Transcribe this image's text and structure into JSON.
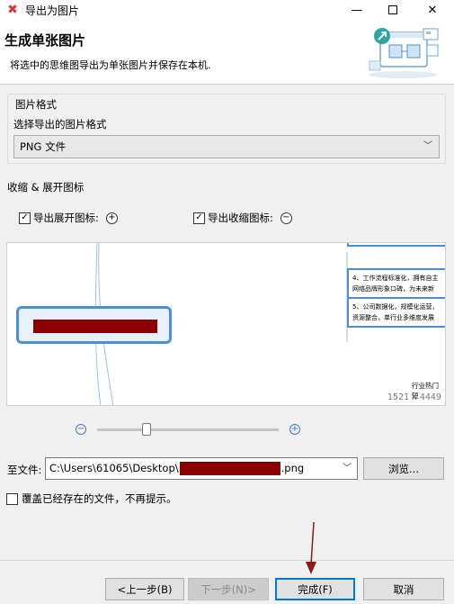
{
  "window": {
    "title": "导出为图片",
    "app_icon": "xmind-logo-icon",
    "controls": {
      "minimize": "—",
      "close": "✕"
    }
  },
  "header": {
    "title": "生成单张图片",
    "subtitle": "将选中的思维图导出为单张图片并保存在本机."
  },
  "format_group": {
    "legend": "图片格式",
    "label": "选择导出的图片格式",
    "selected": "PNG 文件"
  },
  "collapse_section": {
    "label": "收缩 & 展开图标",
    "export_expand": {
      "label": "导出展开图标:",
      "checked": true,
      "icon": "plus-circle-icon"
    },
    "export_collapse": {
      "label": "导出收缩图标:",
      "checked": true,
      "icon": "minus-circle-icon"
    }
  },
  "preview": {
    "node_lines": [
      "4、工作流程标准化，拥有自主",
      "网络品牌形象口碑，为未来新",
      "5、公司数据化，规模化运营，",
      "资源整合，单行业多维度发展"
    ],
    "trend_label": "行业热门短",
    "dimensions": "1521 x 4449"
  },
  "zoom": {
    "minus": "−",
    "plus": "+",
    "level": 0.25
  },
  "file": {
    "label": "至文件:",
    "path_prefix": "C:\\Users\\61065\\Desktop\\",
    "path_suffix": ".png",
    "browse": "浏览..."
  },
  "overwrite": {
    "label": "覆盖已经存在的文件，不再提示。",
    "checked": false
  },
  "buttons": {
    "prev": "<上一步(B)",
    "next": "下一步(N)>",
    "finish": "完成(F)",
    "cancel": "取消"
  },
  "colors": {
    "accent": "#0078d7",
    "node_border": "#4a90d9",
    "redaction": "#8b0000",
    "annotation_arrow": "#8b1a1a"
  }
}
